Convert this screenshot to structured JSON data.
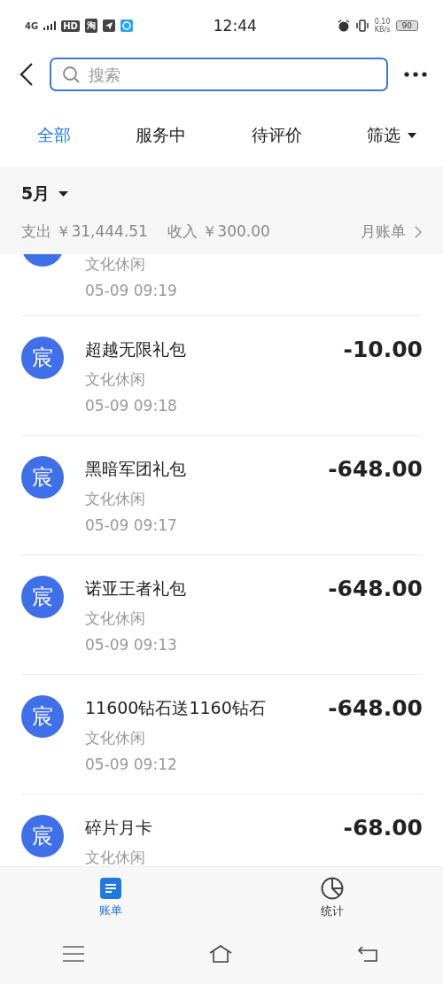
{
  "status_bar": {
    "network": "4G",
    "hd": "HD",
    "app_badge": "淘",
    "time": "12:44",
    "speed": "0.10",
    "speed_unit": "KB/s",
    "battery": "90"
  },
  "header": {
    "search": {
      "placeholder": "搜索"
    }
  },
  "tabs": [
    {
      "label": "全部",
      "selected": true
    },
    {
      "label": "服务中",
      "selected": false
    },
    {
      "label": "待评价",
      "selected": false
    }
  ],
  "filter": {
    "label": "筛选"
  },
  "summary": {
    "month": "5月",
    "expense": "支出 ￥31,444.51",
    "income": "收入 ￥300.00",
    "monthly_bill": "月账单"
  },
  "transactions": [
    {
      "kind": "partial",
      "category": "文化休闲",
      "time": "05-09  09:19"
    },
    {
      "kind": "full",
      "avatar": "宸",
      "title": "超越无限礼包",
      "amount": "-10.00",
      "category": "文化休闲",
      "time": "05-09  09:18"
    },
    {
      "kind": "full",
      "avatar": "宸",
      "title": "黑暗军团礼包",
      "amount": "-648.00",
      "category": "文化休闲",
      "time": "05-09  09:17"
    },
    {
      "kind": "full",
      "avatar": "宸",
      "title": "诺亚王者礼包",
      "amount": "-648.00",
      "category": "文化休闲",
      "time": "05-09  09:13"
    },
    {
      "kind": "full",
      "avatar": "宸",
      "title": "11600钻石送1160钻石",
      "amount": "-648.00",
      "category": "文化休闲",
      "time": "05-09  09:12"
    },
    {
      "kind": "full",
      "avatar": "宸",
      "title": "碎片月卡",
      "amount": "-68.00",
      "category": "文化休闲"
    }
  ],
  "bottom_nav": [
    {
      "kind": "bill",
      "label": "账单",
      "selected": true
    },
    {
      "kind": "stats",
      "label": "统计",
      "selected": false
    }
  ]
}
